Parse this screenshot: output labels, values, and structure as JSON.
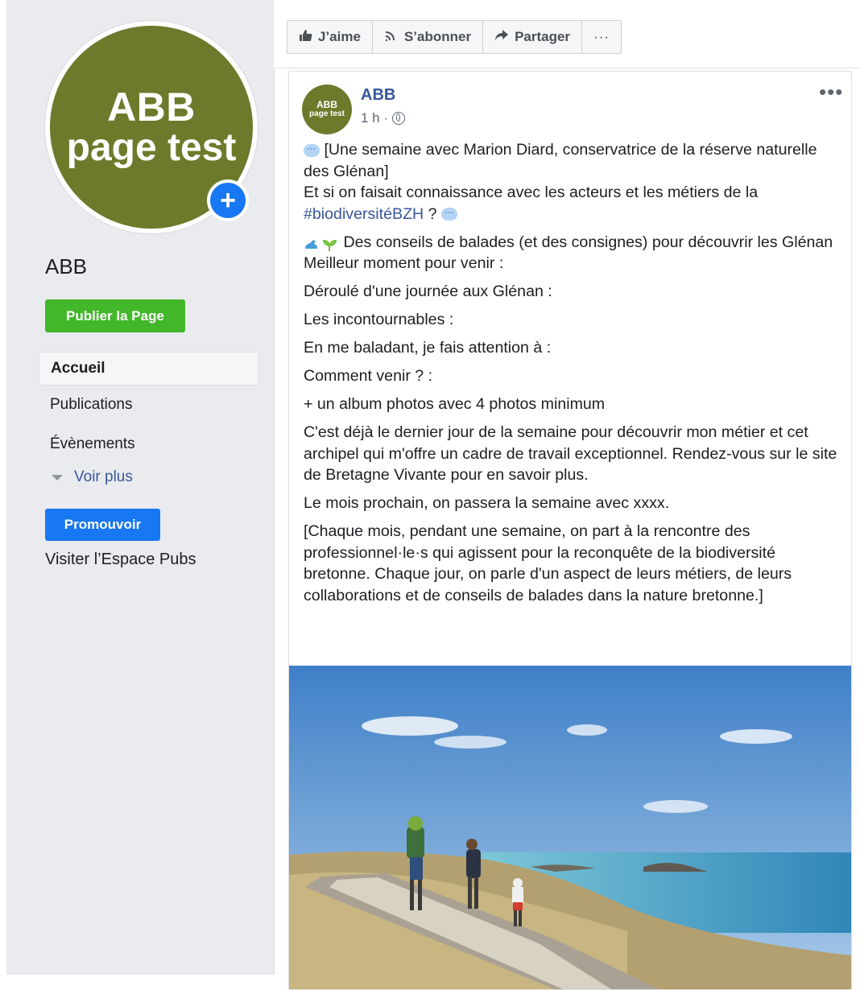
{
  "sidebar": {
    "profile_line1": "ABB",
    "profile_line2": "page test",
    "page_name": "ABB",
    "publish_label": "Publier la Page",
    "nav": [
      {
        "label": "Accueil"
      },
      {
        "label": "Publications"
      },
      {
        "label": "Évènements"
      }
    ],
    "see_more_label": "Voir plus",
    "promote_label": "Promouvoir",
    "ads_link_label": "Visiter l’Espace Pubs"
  },
  "action_bar": {
    "like_label": "J’aime",
    "follow_label": "S’abonner",
    "share_label": "Partager",
    "more_label": "···"
  },
  "post": {
    "avatar_line1": "ABB",
    "avatar_line2": "page test",
    "author": "ABB",
    "time": "1 h ·",
    "menu": "•••",
    "intro": "[Une semaine avec Marion Diard, conservatrice de la réserve naturelle des Glénan]",
    "question": "Et si on faisait connaissance avec les acteurs et les métiers de la",
    "hashtag": "#biodiversitéBZH",
    "question_end": " ?",
    "tips": " Des conseils de balades (et des consignes) pour découvrir les Glénan",
    "best_time": "Meilleur moment pour venir :",
    "day": "Déroulé d'une journée aux Glénan :",
    "musts": "Les incontournables :",
    "attention": "En me baladant, je fais attention à :",
    "how_to": "Comment venir ? :",
    "album": "+ un album photos avec 4 photos minimum",
    "last_day": "C'est déjà le dernier jour de la semaine pour découvrir mon métier et cet archipel qui m'offre un cadre de travail exceptionnel. Rendez-vous sur le site de Bretagne Vivante pour en savoir plus.",
    "next_month": "Le mois prochain, on passera la semaine avec xxxx.",
    "footer": "[Chaque mois, pendant une semaine, on part à la rencontre des professionnel·le·s qui agissent pour la reconquête de la biodiversité bretonne. Chaque jour, on parle d'un aspect de leurs métiers, de leurs collaborations et de conseils de balades dans la nature bretonne.]"
  },
  "colors": {
    "brand_olive": "#6b7b2b",
    "publish_green": "#42b72a",
    "promote_blue": "#1877f2",
    "link_blue": "#385898"
  }
}
